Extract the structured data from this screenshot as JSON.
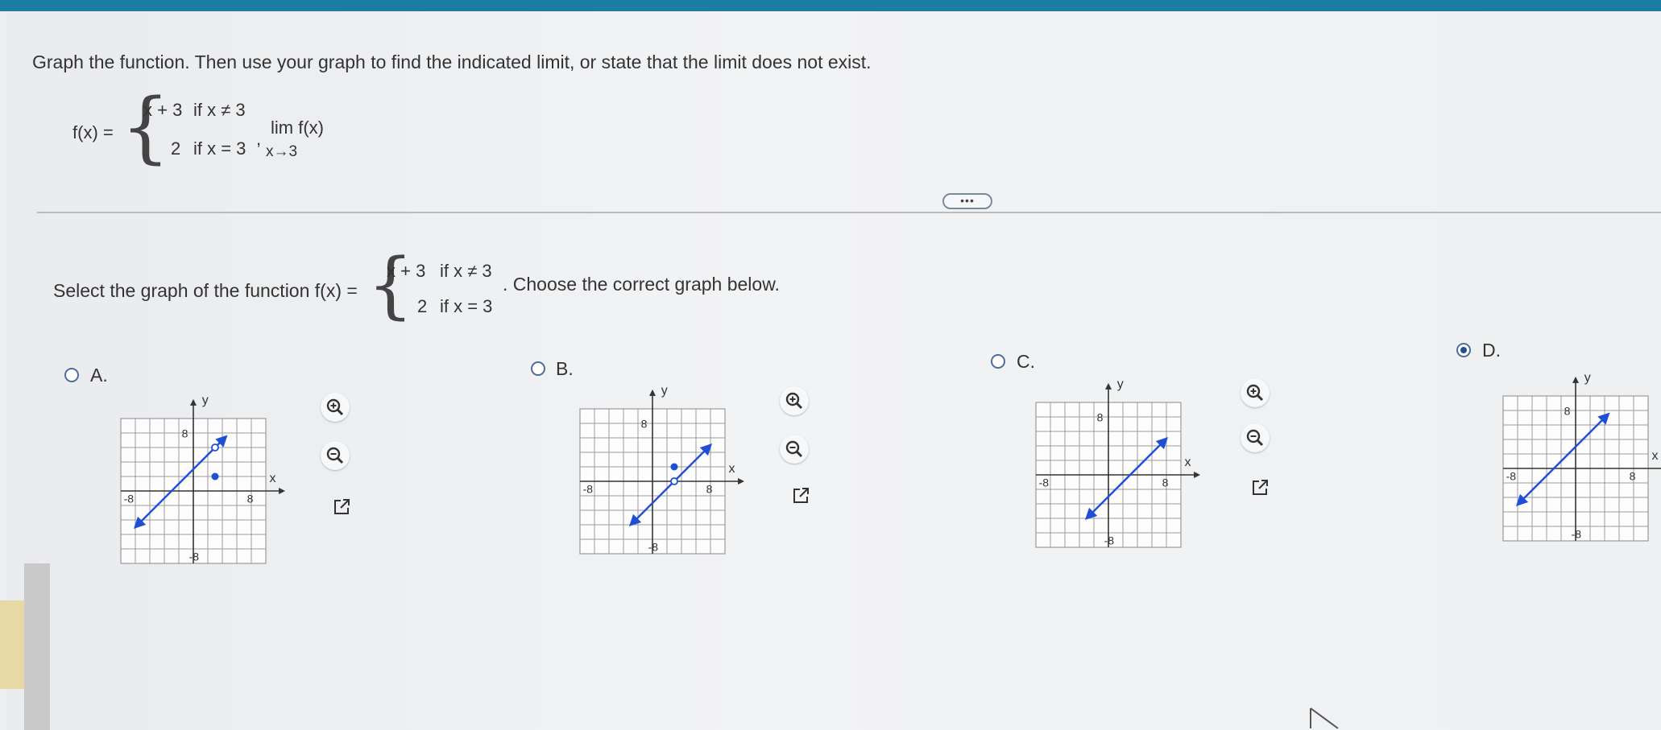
{
  "question": {
    "instruction": "Graph the function. Then use your graph to find the indicated limit, or state that the limit does not exist.",
    "fx_label": "f(x) =",
    "case1_expr": "x + 3",
    "case1_cond": "if x ≠ 3",
    "case2_expr": "2",
    "case2_cond": "if x = 3",
    "separator": ",",
    "limit_word": "lim f(x)",
    "limit_sub": "x→3"
  },
  "more_button_label": "•••",
  "part": {
    "prompt_before": "Select the graph of the function f(x) =",
    "case1_expr": "x + 3",
    "case1_cond": "if x ≠ 3",
    "case2_expr": "2",
    "case2_cond": "if x = 3",
    "prompt_after": ". Choose the correct graph below."
  },
  "options": [
    {
      "label": "A.",
      "selected": false
    },
    {
      "label": "B.",
      "selected": false
    },
    {
      "label": "C.",
      "selected": false
    },
    {
      "label": "D.",
      "selected": true
    }
  ],
  "graph_text": {
    "axis_y": "y",
    "axis_x": "x",
    "tick_pos": "8",
    "tick_neg": "-8"
  },
  "graphs": [
    {
      "option": "A",
      "line_x_range": [
        -8,
        4.5
      ],
      "line": "y = x + 3",
      "open_circle": [
        3,
        6
      ],
      "filled_point": [
        3,
        2
      ]
    },
    {
      "option": "B",
      "line_x_range": [
        -3,
        8
      ],
      "line": "y = x - 3",
      "open_circle": [
        3,
        0
      ],
      "filled_point": [
        3,
        2
      ]
    },
    {
      "option": "C",
      "line_x_range": [
        -3,
        8
      ],
      "line": "y = x - 3"
    },
    {
      "option": "D",
      "line_x_range": [
        -8,
        4.5
      ],
      "line": "y = x + 3"
    }
  ],
  "tools": [
    "zoom-in-icon",
    "zoom-out-icon",
    "open-external-icon"
  ],
  "colors": {
    "accent_blue": "#1f4fd6",
    "header_bar": "#1d7ca2",
    "grid": "#9a9a9a"
  }
}
